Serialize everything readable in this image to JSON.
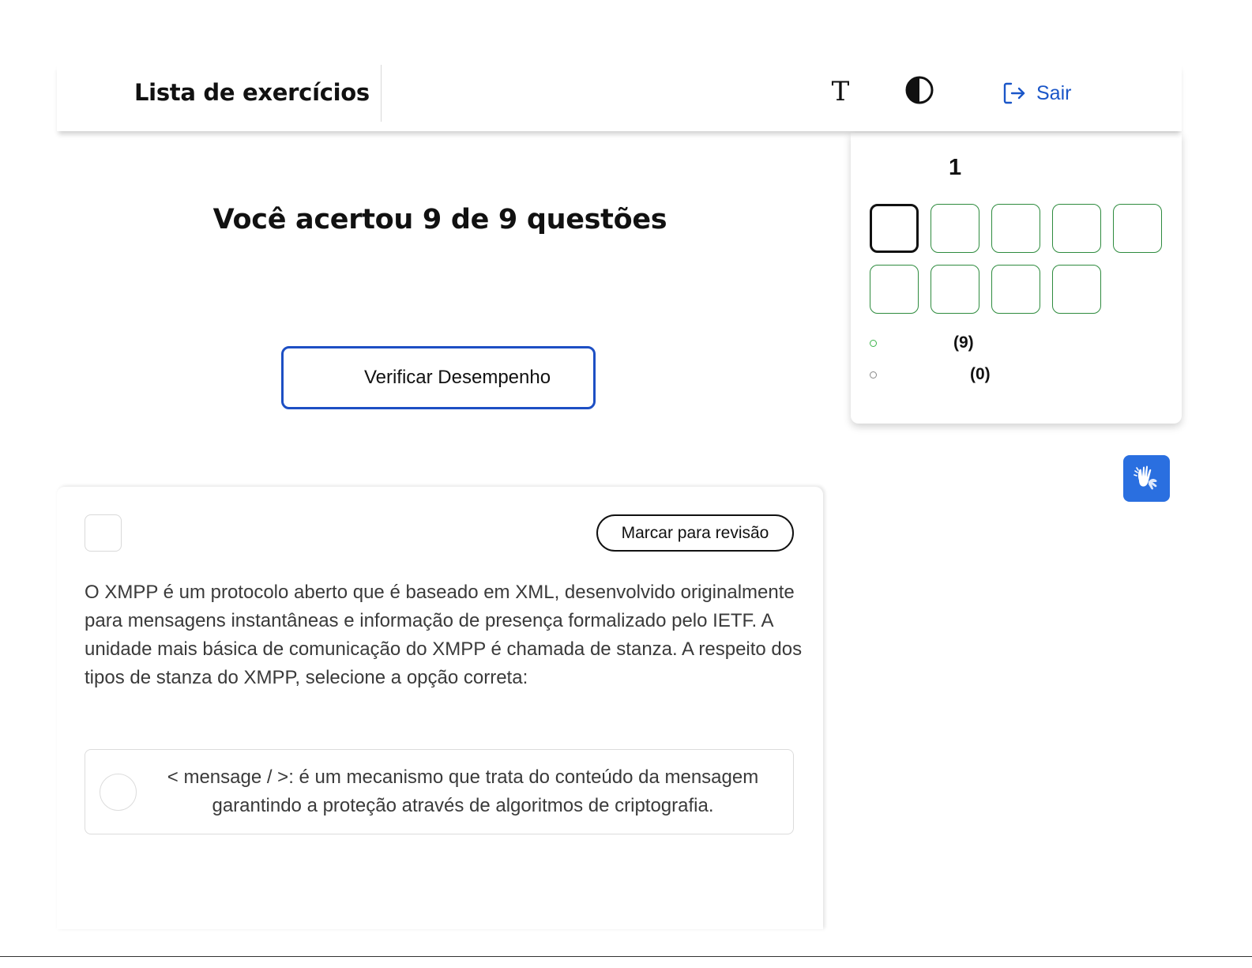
{
  "header": {
    "title": "Lista de exercícios",
    "font_icon": "text-size-icon",
    "font_glyph": "T",
    "contrast_icon": "contrast-icon",
    "logout_icon": "logout-icon",
    "logout_label": "Sair"
  },
  "result": {
    "title": "Você acertou 9 de 9 questões",
    "verify_label": "Verificar Desempenho"
  },
  "navigator": {
    "current_number": "1",
    "questions": [
      {
        "state": "active"
      },
      {
        "state": "answered"
      },
      {
        "state": "answered"
      },
      {
        "state": "answered"
      },
      {
        "state": "answered"
      },
      {
        "state": "answered"
      },
      {
        "state": "answered"
      },
      {
        "state": "answered"
      },
      {
        "state": "answered"
      }
    ],
    "legend": [
      {
        "count": "(9)",
        "color": "#3cb44b"
      },
      {
        "count": "(0)",
        "color": "#888888"
      }
    ]
  },
  "accessibility": {
    "libras_icon": "sign-language-icon"
  },
  "question": {
    "review_label": "Marcar para revisão",
    "text": "O XMPP é um protocolo aberto que é baseado em XML, desenvolvido originalmente para mensagens instantâneas e informação de presença formalizado pelo IETF. A unidade mais básica de comunicação do XMPP é chamada de stanza. A respeito dos tipos de stanza do XMPP, selecione a opção correta:",
    "options": [
      {
        "text": "< mensage / >: é um mecanismo que trata do conteúdo da mensagem garantindo a proteção através de algoritmos de criptografia."
      }
    ]
  },
  "colors": {
    "accent_blue": "#1d4fc4",
    "answered_green": "#2e8b3e",
    "libras_blue": "#2a6fe0"
  }
}
